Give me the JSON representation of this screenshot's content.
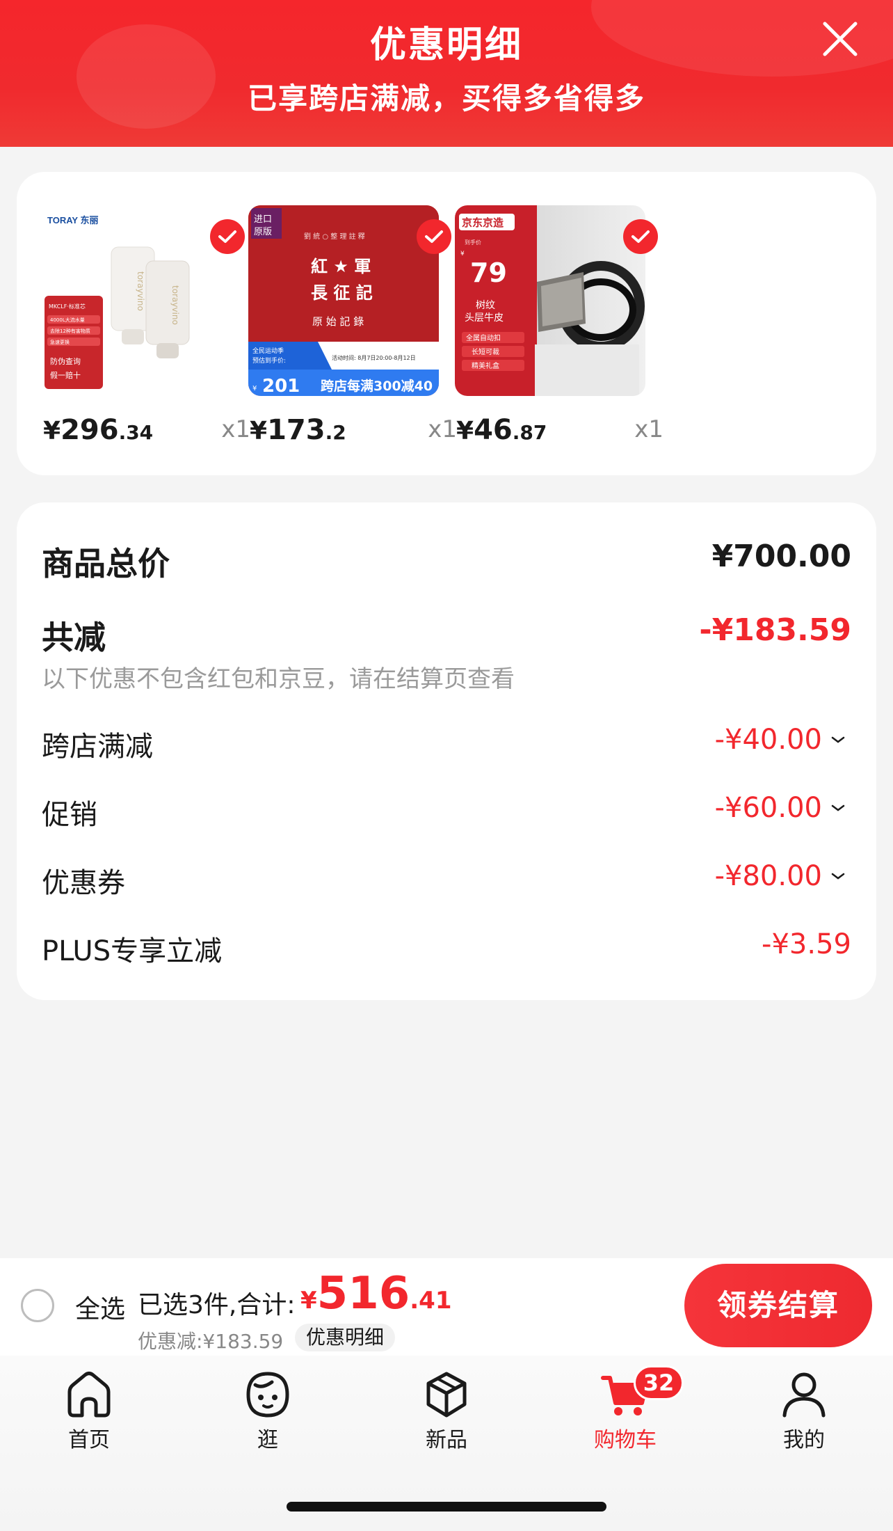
{
  "header": {
    "title": "优惠明细",
    "subtitle": "已享跨店满减，买得多省得多"
  },
  "products": [
    {
      "price_int": "296",
      "price_dec": ".34",
      "qty": "x1",
      "checked": true,
      "image": {
        "brand": "TORAY 东丽",
        "lines": [
          "MKCLF·标准芯",
          "4000L大流水量",
          "去除12种有害物质",
          "急速更换"
        ],
        "tag": "防伪查询 假一赔十"
      }
    },
    {
      "price_int": "173",
      "price_dec": ".2",
      "qty": "x1",
      "checked": true,
      "image": {
        "corner": "进口原版",
        "lines": [
          "紅軍",
          "長征記"
        ],
        "sub": "原始記錄",
        "promo_left": "全民运动季 预估到手价:",
        "promo_price": "201",
        "promo_right": "跨店每满300减40"
      }
    },
    {
      "price_int": "46",
      "price_dec": ".87",
      "qty": "x1",
      "checked": true,
      "image": {
        "brand": "京东京造",
        "price": "79",
        "lines": [
          "树纹",
          "头层牛皮"
        ],
        "tags": [
          "全属自动扣",
          "长短可裁",
          "精美礼盒"
        ]
      }
    }
  ],
  "currency": "¥",
  "summary": {
    "total_label": "商品总价",
    "total_value": "¥700.00",
    "reduce_label": "共减",
    "reduce_value": "-¥183.59",
    "note": "以下优惠不包含红包和京豆，请在结算页查看",
    "details": [
      {
        "label": "跨店满减",
        "value": "-¥40.00",
        "expandable": true
      },
      {
        "label": "促销",
        "value": "-¥60.00",
        "expandable": true
      },
      {
        "label": "优惠券",
        "value": "-¥80.00",
        "expandable": true
      },
      {
        "label": "PLUS专享立减",
        "value": "-¥3.59",
        "expandable": false
      }
    ]
  },
  "bottom_bar": {
    "select_all": "全选",
    "selected_text": "已选3件,合计:",
    "total_yen": "¥",
    "total_int": "516",
    "total_dec": ".41",
    "discount_text": "优惠减:¥183.59",
    "detail_chip": "优惠明细",
    "checkout": "领券结算"
  },
  "tabs": [
    {
      "label": "首页",
      "icon": "home-icon",
      "active": false
    },
    {
      "label": "逛",
      "icon": "face-icon",
      "active": false
    },
    {
      "label": "新品",
      "icon": "cube-icon",
      "active": false
    },
    {
      "label": "购物车",
      "icon": "cart-icon",
      "active": true,
      "badge": "32"
    },
    {
      "label": "我的",
      "icon": "profile-icon",
      "active": false
    }
  ],
  "colors": {
    "accent": "#f2272d",
    "header_bg": "#f5262c",
    "background": "#f4f4f4"
  }
}
